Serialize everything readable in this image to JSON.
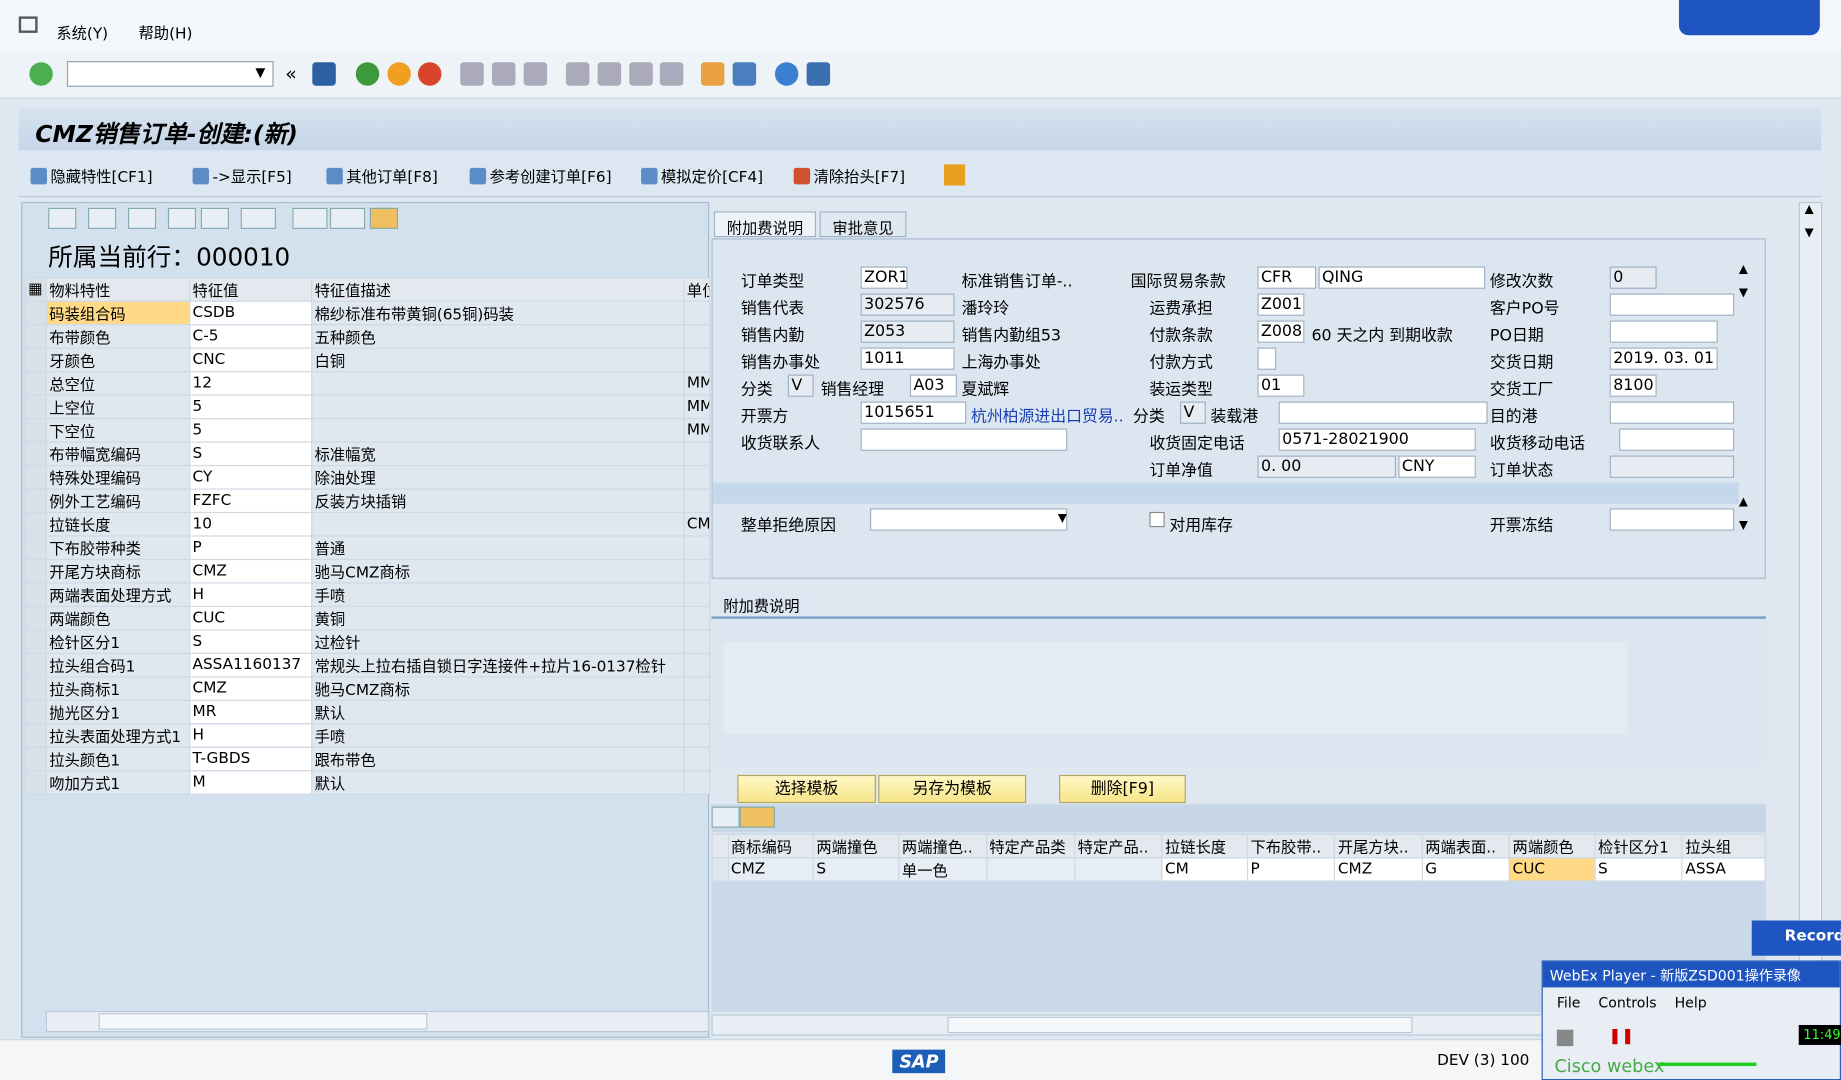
{
  "menu": {
    "items": [
      "系统(Y)",
      "帮助(H)"
    ]
  },
  "title": "CMZ销售订单-创建:(新)",
  "app_toolbar": [
    "隐藏特性[CF1]",
    "->显示[F5]",
    "其他订单[F8]",
    "参考创建订单[F6]",
    "模拟定价[CF4]",
    "清除抬头[F7]"
  ],
  "left": {
    "current_row_label": "所属当前行：",
    "current_row": "000010",
    "headers": [
      "物料特性",
      "特征值",
      "特征值描述",
      "单位"
    ],
    "rows": [
      [
        "码装组合码",
        "CSDB",
        "棉纱标准布带黄铜(65铜)码装",
        ""
      ],
      [
        "布带颜色",
        "C-5",
        "五种颜色",
        ""
      ],
      [
        "牙颜色",
        "CNC",
        "白铜",
        ""
      ],
      [
        "总空位",
        "12",
        "",
        "MM"
      ],
      [
        "上空位",
        "5",
        "",
        "MM"
      ],
      [
        "下空位",
        "5",
        "",
        "MM"
      ],
      [
        "布带幅宽编码",
        "S",
        "标准幅宽",
        ""
      ],
      [
        "特殊处理编码",
        "CY",
        "除油处理",
        ""
      ],
      [
        "例外工艺编码",
        "FZFC",
        "反装方块插销",
        ""
      ],
      [
        "拉链长度",
        "10",
        "",
        "CM"
      ],
      [
        "下布胶带种类",
        "P",
        "普通",
        ""
      ],
      [
        "开尾方块商标",
        "CMZ",
        "驰马CMZ商标",
        ""
      ],
      [
        "两端表面处理方式",
        "H",
        "手喷",
        ""
      ],
      [
        "两端颜色",
        "CUC",
        "黄铜",
        ""
      ],
      [
        "检针区分1",
        "S",
        "过检针",
        ""
      ],
      [
        "拉头组合码1",
        "ASSA1160137",
        "常规头上拉右插自锁日字连接件+拉片16-0137检针",
        ""
      ],
      [
        "拉头商标1",
        "CMZ",
        "驰马CMZ商标",
        ""
      ],
      [
        "抛光区分1",
        "MR",
        "默认",
        ""
      ],
      [
        "拉头表面处理方式1",
        "H",
        "手喷",
        ""
      ],
      [
        "拉头颜色1",
        "T-GBDS",
        "跟布带色",
        ""
      ],
      [
        "吻加方式1",
        "M",
        "默认",
        ""
      ]
    ]
  },
  "tabs": [
    "附加费说明",
    "审批意见"
  ],
  "header": {
    "order_type": {
      "label": "订单类型",
      "value": "ZOR1",
      "desc": "标准销售订单-.."
    },
    "sales_rep": {
      "label": "销售代表",
      "value": "302576",
      "desc": "潘玲玲"
    },
    "sales_inner": {
      "label": "销售内勤",
      "value": "Z053",
      "desc": "销售内勤组53"
    },
    "sales_office": {
      "label": "销售办事处",
      "value": "1011",
      "desc": "上海办事处"
    },
    "class1": {
      "label": "分类",
      "value": "V"
    },
    "sales_manager": {
      "label": "销售经理",
      "value": "A03",
      "desc": "夏斌辉"
    },
    "bill_to": {
      "label": "开票方",
      "value": "1015651",
      "desc": "杭州柏源进出口贸易.."
    },
    "consignee": {
      "label": "收货联系人",
      "value": ""
    },
    "incoterms": {
      "label": "国际贸易条款",
      "value": "CFR",
      "value2": "QING"
    },
    "freight": {
      "label": "运费承担",
      "value": "Z001"
    },
    "payment_terms": {
      "label": "付款条款",
      "value": "Z008",
      "desc": "60 天之内 到期收款"
    },
    "payment_method": {
      "label": "付款方式",
      "value": ""
    },
    "shipping_type": {
      "label": "装运类型",
      "value": "01"
    },
    "class2": {
      "label": "分类",
      "value": "V"
    },
    "load_port": {
      "label": "装载港",
      "value": ""
    },
    "phone": {
      "label": "收货固定电话",
      "value": "0571-28021900"
    },
    "net_value": {
      "label": "订单净值",
      "value": "0. 00",
      "currency": "CNY"
    },
    "revisions": {
      "label": "修改次数",
      "value": "0"
    },
    "customer_po": {
      "label": "客户PO号",
      "value": ""
    },
    "po_date": {
      "label": "PO日期",
      "value": ""
    },
    "delivery_date": {
      "label": "交货日期",
      "value": "2019. 03. 01"
    },
    "plant": {
      "label": "交货工厂",
      "value": "8100"
    },
    "dest_port": {
      "label": "目的港",
      "value": ""
    },
    "mobile": {
      "label": "收货移动电话",
      "value": ""
    },
    "status": {
      "label": "订单状态",
      "value": ""
    },
    "reject_reason": {
      "label": "整单拒绝原因",
      "value": ""
    },
    "use_stock": {
      "label": "对用库存",
      "checked": false
    },
    "billing_block": {
      "label": "开票冻结",
      "value": ""
    }
  },
  "section2_tab": "附加费说明",
  "buttons": {
    "select_template": "选择模板",
    "save_template": "另存为模板",
    "delete": "删除[F9]"
  },
  "bottom_table": {
    "headers": [
      "商标编码",
      "两端撞色",
      "两端撞色..",
      "特定产品类",
      "特定产品..",
      "拉链长度",
      "下布胶带..",
      "开尾方块..",
      "两端表面..",
      "两端颜色",
      "检针区分1",
      "拉头组"
    ],
    "rows": [
      [
        "CMZ",
        "S",
        "单一色",
        "",
        "",
        "CM",
        "P",
        "CMZ",
        "G",
        "CUC",
        "S",
        "ASSA"
      ]
    ]
  },
  "status_bar": {
    "system": "DEV (3) 100",
    "logo": "SAP"
  },
  "webex": {
    "title": "WebEx Player - 新版ZSD001操作录像",
    "menu": [
      "File",
      "Controls",
      "Help"
    ],
    "time": "11:49",
    "recorder": "Recorder",
    "brand": "Cisco webex"
  }
}
